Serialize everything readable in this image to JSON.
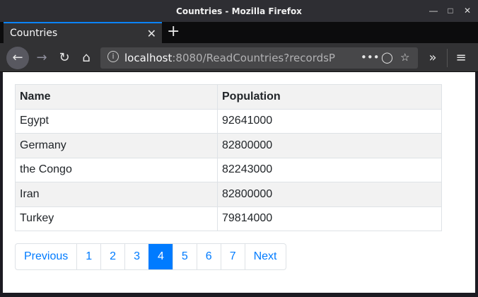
{
  "window": {
    "title": "Countries - Mozilla Firefox"
  },
  "tab": {
    "label": "Countries"
  },
  "urlbar": {
    "host": "localhost",
    "rest": ":8080/ReadCountries?recordsPerPa"
  },
  "table": {
    "headers": [
      "Name",
      "Population"
    ],
    "rows": [
      [
        "Egypt",
        "92641000"
      ],
      [
        "Germany",
        "82800000"
      ],
      [
        "the Congo",
        "82243000"
      ],
      [
        "Iran",
        "82800000"
      ],
      [
        "Turkey",
        "79814000"
      ]
    ]
  },
  "pagination": {
    "previous": "Previous",
    "pages": [
      "1",
      "2",
      "3",
      "4",
      "5",
      "6",
      "7"
    ],
    "next": "Next",
    "active_page": "4"
  },
  "colors": {
    "accent": "#007bff",
    "tab_accent": "#0a84ff"
  }
}
